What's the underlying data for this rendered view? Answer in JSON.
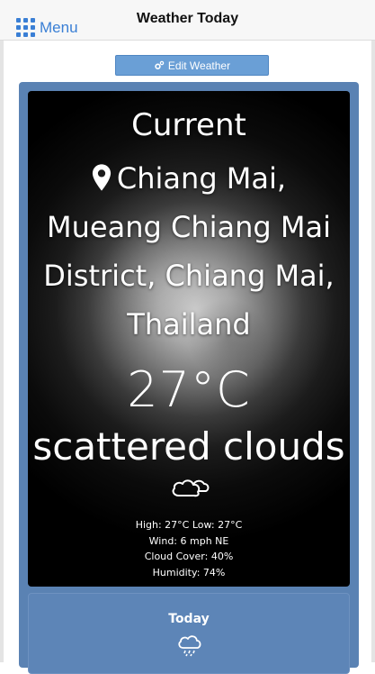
{
  "header": {
    "menu_label": "Menu",
    "title": "Weather Today"
  },
  "toolbar": {
    "edit_label": "Edit Weather"
  },
  "current": {
    "label": "Current",
    "location": "Chiang Mai, Mueang Chiang Mai District, Chiang Mai, Thailand",
    "temperature": "27°C",
    "description": "scattered clouds",
    "icon": "cloud-icon",
    "high_low": "High: 27°C Low: 27°C",
    "wind": "Wind: 6 mph NE",
    "cloud_cover": "Cloud Cover: 40%",
    "humidity": "Humidity: 74%"
  },
  "forecast": {
    "today_label": "Today",
    "today_icon": "cloud-rain-icon"
  },
  "colors": {
    "accent": "#3a7fd5",
    "panel": "#5a82b3",
    "edit_button": "#6a9fd6"
  }
}
